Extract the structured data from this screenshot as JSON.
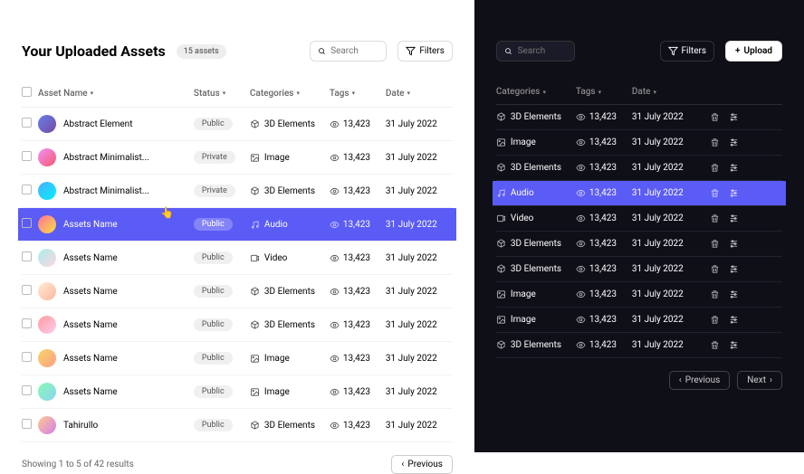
{
  "title": "Your Uploaded Assets",
  "badge": "15 assets",
  "search_ph": "Search",
  "filters": "Filters",
  "upload": "Upload",
  "cols": {
    "name": "Asset Name",
    "status": "Status",
    "cat": "Categories",
    "tags": "Tags",
    "date": "Date"
  },
  "rows": [
    {
      "name": "Abstract Element",
      "status": "Public",
      "cat": "3D Elements",
      "caticon": "3d",
      "tags": "13,423",
      "date": "31 July 2022",
      "av": "linear-gradient(135deg,#667eea,#764ba2)"
    },
    {
      "name": "Abstract Minimalist...",
      "status": "Private",
      "cat": "Image",
      "caticon": "img",
      "tags": "13,423",
      "date": "31 July 2022",
      "av": "linear-gradient(135deg,#f093fb,#f5576c)"
    },
    {
      "name": "Abstract Minimalist...",
      "status": "Private",
      "cat": "3D Elements",
      "caticon": "3d",
      "tags": "13,423",
      "date": "31 July 2022",
      "av": "linear-gradient(135deg,#4facfe,#00f2fe)"
    },
    {
      "name": "Assets Name",
      "status": "Public",
      "cat": "Audio",
      "caticon": "aud",
      "tags": "13,423",
      "date": "31 July 2022",
      "av": "linear-gradient(135deg,#fa709a,#fee140)",
      "sel": true
    },
    {
      "name": "Assets Name",
      "status": "Public",
      "cat": "Video",
      "caticon": "vid",
      "tags": "13,423",
      "date": "31 July 2022",
      "av": "linear-gradient(135deg,#a8edea,#fed6e3)"
    },
    {
      "name": "Assets Name",
      "status": "Public",
      "cat": "3D Elements",
      "caticon": "3d",
      "tags": "13,423",
      "date": "31 July 2022",
      "av": "linear-gradient(135deg,#ffecd2,#fcb69f)"
    },
    {
      "name": "Assets Name",
      "status": "Public",
      "cat": "3D Elements",
      "caticon": "3d",
      "tags": "13,423",
      "date": "31 July 2022",
      "av": "linear-gradient(135deg,#ff9a9e,#fecfef)"
    },
    {
      "name": "Assets Name",
      "status": "Public",
      "cat": "Image",
      "caticon": "img",
      "tags": "13,423",
      "date": "31 July 2022",
      "av": "linear-gradient(135deg,#f6d365,#fda085)"
    },
    {
      "name": "Assets Name",
      "status": "Public",
      "cat": "Image",
      "caticon": "img",
      "tags": "13,423",
      "date": "31 July 2022",
      "av": "linear-gradient(135deg,#84fab0,#8fd3f4)"
    },
    {
      "name": "Tahirullo",
      "status": "Public",
      "cat": "3D Elements",
      "caticon": "3d",
      "tags": "13,423",
      "date": "31 July 2022",
      "av": "linear-gradient(135deg,#fccb90,#d57eeb)"
    }
  ],
  "results": "Showing 1 to 5 of 42 results",
  "prev": "Previous",
  "next": "Next"
}
